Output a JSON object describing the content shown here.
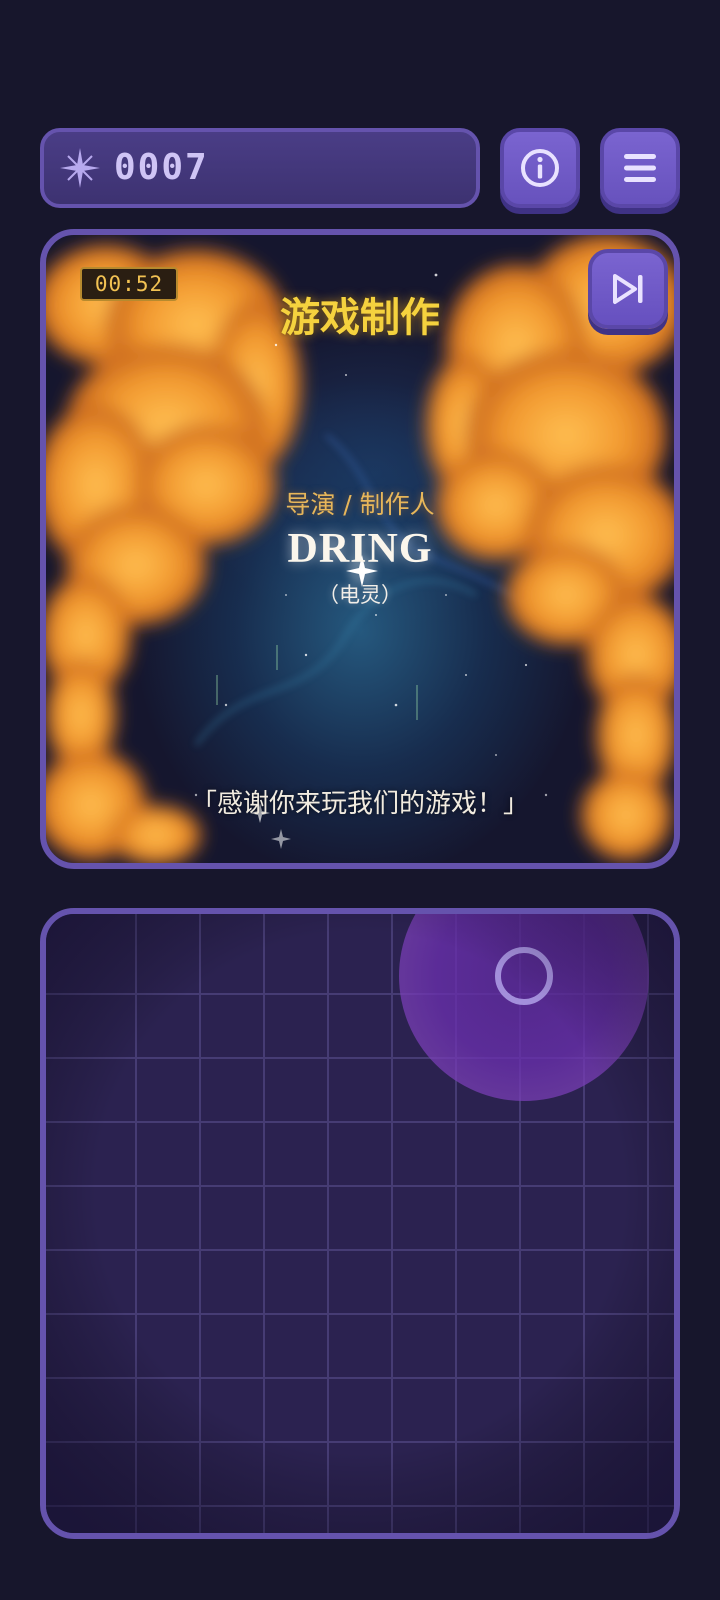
{
  "header": {
    "score": "0007",
    "score_icon": "sparkle-icon",
    "info_icon": "info-icon",
    "menu_icon": "hamburger-menu-icon"
  },
  "cutscene": {
    "timer": "00:52",
    "skip_icon": "skip-forward-icon",
    "title": "游戏制作",
    "role": "导演 / 制作人",
    "name": "DRING",
    "alias": "（电灵）",
    "quote": "「感谢你来玩我们的游戏！」"
  },
  "colors": {
    "background": "#17162c",
    "panel_border": "#6553ad",
    "button": "#7a64d0",
    "title_gold": "#f5d23e",
    "fire_orange": "#f5a638",
    "grid_bg": "#2b2250",
    "cursor_purple": "#7b3fb8"
  }
}
